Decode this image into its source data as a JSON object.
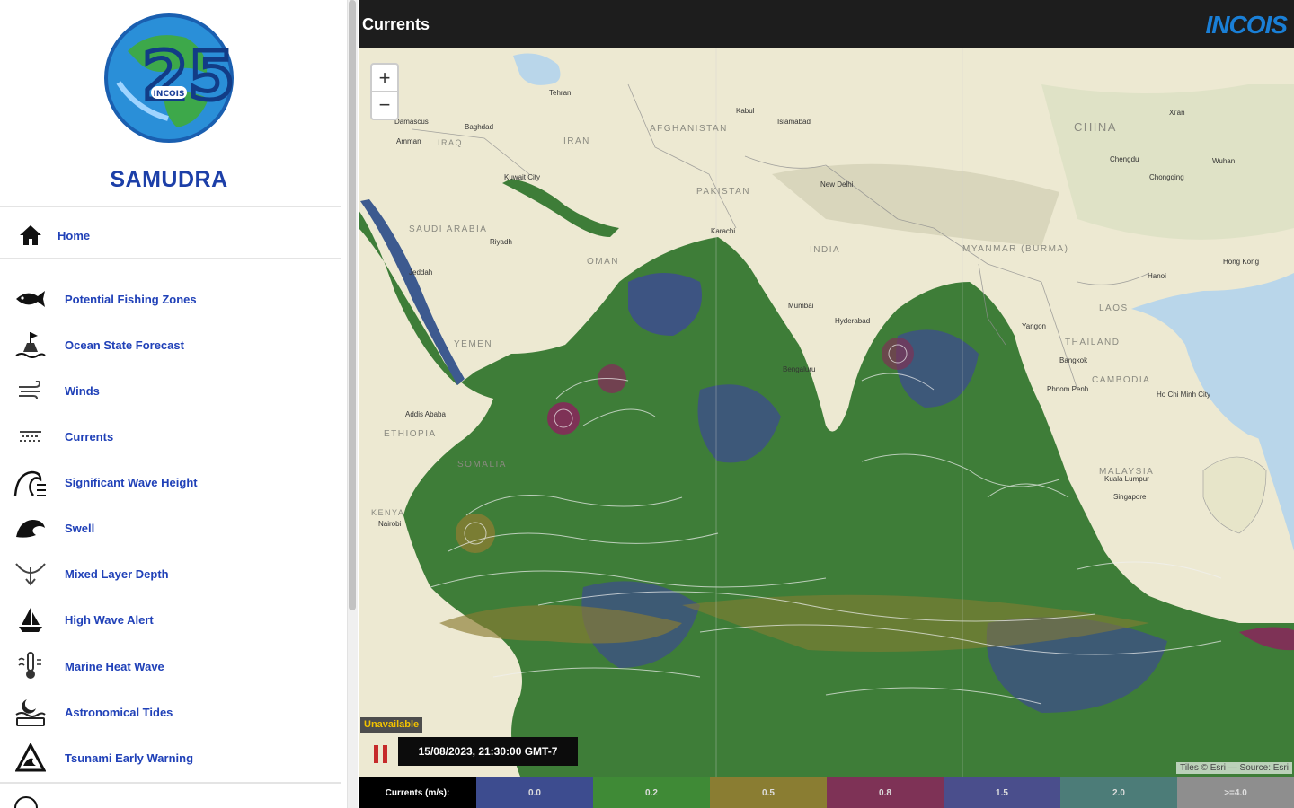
{
  "sidebar": {
    "app_title": "SAMUDRA",
    "logo": {
      "number": "25",
      "org": "INCOIS"
    },
    "items": [
      {
        "label": "Home",
        "icon": "home-icon"
      },
      {
        "label": "Potential Fishing Zones",
        "icon": "fish-icon"
      },
      {
        "label": "Ocean State Forecast",
        "icon": "buoy-icon"
      },
      {
        "label": "Winds",
        "icon": "wind-icon"
      },
      {
        "label": "Currents",
        "icon": "currents-icon"
      },
      {
        "label": "Significant Wave Height",
        "icon": "wave-height-icon"
      },
      {
        "label": "Swell",
        "icon": "swell-icon"
      },
      {
        "label": "Mixed Layer Depth",
        "icon": "mixed-layer-icon"
      },
      {
        "label": "High Wave Alert",
        "icon": "boat-icon"
      },
      {
        "label": "Marine Heat Wave",
        "icon": "thermometer-icon"
      },
      {
        "label": "Astronomical Tides",
        "icon": "tides-icon"
      },
      {
        "label": "Tsunami Early Warning",
        "icon": "warning-icon"
      }
    ]
  },
  "header": {
    "title": "Currents",
    "brand": "INCOIS"
  },
  "map": {
    "zoom_in": "+",
    "zoom_out": "−",
    "unavailable": "Unavailable",
    "datetime": "15/08/2023, 21:30:00 GMT-7",
    "attribution": "Tiles © Esri — Source: Esri",
    "labels": [
      {
        "text": "CHINA"
      },
      {
        "text": "AFGHANISTAN"
      },
      {
        "text": "IRAN"
      },
      {
        "text": "IRAQ"
      },
      {
        "text": "PAKISTAN"
      },
      {
        "text": "INDIA"
      },
      {
        "text": "SAUDI ARABIA"
      },
      {
        "text": "OMAN"
      },
      {
        "text": "YEMEN"
      },
      {
        "text": "ETHIOPIA"
      },
      {
        "text": "SOMALIA"
      },
      {
        "text": "KENYA"
      },
      {
        "text": "THAILAND"
      },
      {
        "text": "MYANMAR (BURMA)"
      },
      {
        "text": "LAOS"
      },
      {
        "text": "CAMBODIA"
      },
      {
        "text": "MALAYSIA"
      },
      {
        "text": "Tehran"
      },
      {
        "text": "Baghdad"
      },
      {
        "text": "Kabul"
      },
      {
        "text": "Islamabad"
      },
      {
        "text": "New Delhi"
      },
      {
        "text": "Karachi"
      },
      {
        "text": "Riyadh"
      },
      {
        "text": "Jeddah"
      },
      {
        "text": "Kuwait City"
      },
      {
        "text": "Addis Ababa"
      },
      {
        "text": "Nairobi"
      },
      {
        "text": "Mumbai"
      },
      {
        "text": "Hyderabad"
      },
      {
        "text": "Bengaluru"
      },
      {
        "text": "Yangon"
      },
      {
        "text": "Bangkok"
      },
      {
        "text": "Kuala Lumpur"
      },
      {
        "text": "Singapore"
      },
      {
        "text": "Hanoi"
      },
      {
        "text": "Hong Kong"
      },
      {
        "text": "Chengdu"
      },
      {
        "text": "Chongqing"
      },
      {
        "text": "Wuhan"
      },
      {
        "text": "Xi'an"
      },
      {
        "text": "Ho Chi Minh City"
      },
      {
        "text": "Phnom Penh"
      },
      {
        "text": "Damascus"
      },
      {
        "text": "Amman"
      }
    ]
  },
  "legend": {
    "title": "Currents (m/s):",
    "stops": [
      {
        "label": "0.0",
        "color": "#3d4c8f"
      },
      {
        "label": "0.2",
        "color": "#3f8a36"
      },
      {
        "label": "0.5",
        "color": "#8a7d32"
      },
      {
        "label": "0.8",
        "color": "#7e3256"
      },
      {
        "label": "1.5",
        "color": "#4a4e8c"
      },
      {
        "label": "2.0",
        "color": "#4c7c78"
      },
      {
        "label": ">=4.0",
        "color": "#8e8e8e"
      }
    ]
  },
  "colors": {
    "accent": "#1c3fa8",
    "header_bg": "#1d1d1d",
    "ocean_flow": "#3e7d38"
  }
}
